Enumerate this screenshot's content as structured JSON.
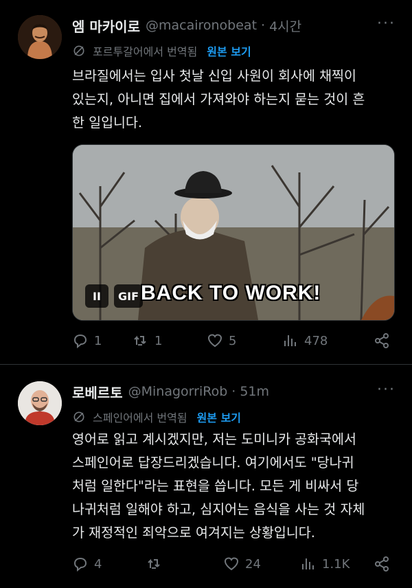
{
  "tweets": [
    {
      "name": "엠 마카이로",
      "handle": "@macaironobeat",
      "time": "4시간",
      "translated_from": "포르투갈어에서 번역됨",
      "view_original": "원본 보기",
      "text": "브라질에서는 입사 첫날 신입 사원이 회사에 채찍이\n있는지, 아니면 집에서 가져와야 하는지 묻는 것이 흔\n한 일입니다.",
      "media": {
        "type": "GIF",
        "gif_label": "GIF",
        "pause_label": "II",
        "caption": "BACK TO WORK!"
      },
      "stats": {
        "replies": "1",
        "retweets": "1",
        "likes": "5",
        "views": "478"
      }
    },
    {
      "name": "로베르토",
      "handle": "@MinagorriRob",
      "time": "51m",
      "translated_from": "스페인어에서 번역됨",
      "view_original": "원본 보기",
      "text": "영어로 읽고 계시겠지만, 저는 도미니카 공화국에서\n스페인어로 답장드리겠습니다. 여기에서도 \"당나귀\n처럼 일한다\"라는 표현을 씁니다. 모든 게 비싸서 당\n나귀처럼 일해야 하고, 심지어는 음식을 사는 것 자체\n가 재정적인 죄악으로 여겨지는 상황입니다.",
      "stats": {
        "replies": "4",
        "retweets": "",
        "likes": "24",
        "views": "1.1K"
      }
    }
  ],
  "more_icon": "···",
  "colors": {
    "link": "#1d9bf0",
    "muted": "#71767b",
    "text": "#e7e9ea",
    "bg": "#000000"
  }
}
